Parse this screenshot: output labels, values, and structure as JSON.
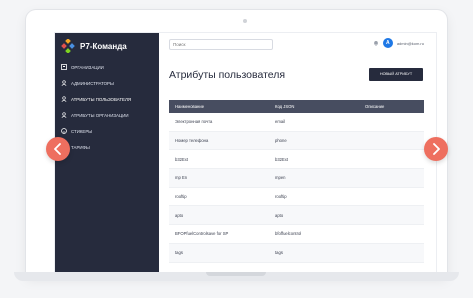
{
  "app": {
    "name": "Р7-Команда",
    "brand_colors": [
      "#f4a623",
      "#4a90e2",
      "#7ed321",
      "#e0504c"
    ]
  },
  "sidebar": {
    "background": "#262b3d",
    "items": [
      {
        "label": "Организации",
        "icon": "building-icon",
        "active": false
      },
      {
        "label": "Администраторы",
        "icon": "user-icon",
        "active": false
      },
      {
        "label": "Атрибуты пользователя",
        "icon": "user-icon",
        "active": true
      },
      {
        "label": "Атрибуты организации",
        "icon": "user-icon",
        "active": false
      },
      {
        "label": "Стикеры",
        "icon": "emoji-icon",
        "active": false
      },
      {
        "label": "Тарифы",
        "icon": "tag-icon",
        "active": false
      }
    ]
  },
  "header": {
    "search_placeholder": "Поиск",
    "avatar_letter": "A",
    "user_email": "admin@kom.ru"
  },
  "main": {
    "title": "Атрибуты пользователя",
    "new_button_label": "Новый атрибут",
    "table": {
      "columns": [
        "Наименование",
        "Код JSON",
        "Описание"
      ],
      "rows": [
        {
          "name": "Электронная почта",
          "code": "email",
          "description": ""
        },
        {
          "name": "Номер телефона",
          "code": "phone",
          "description": ""
        },
        {
          "name": "b32Ext",
          "code": "b32Ext",
          "description": ""
        },
        {
          "name": "mp En",
          "code": "mpen",
          "description": ""
        },
        {
          "name": "rooftip",
          "code": "rooftip",
          "description": ""
        },
        {
          "name": "apto",
          "code": "apto",
          "description": ""
        },
        {
          "name": "BFOPfuelControlsave for SP",
          "code": "bfoffuelcontrol",
          "description": ""
        },
        {
          "name": "tags",
          "code": "tags",
          "description": ""
        }
      ]
    }
  },
  "carousel": {
    "accent": "#ee6f5f"
  }
}
